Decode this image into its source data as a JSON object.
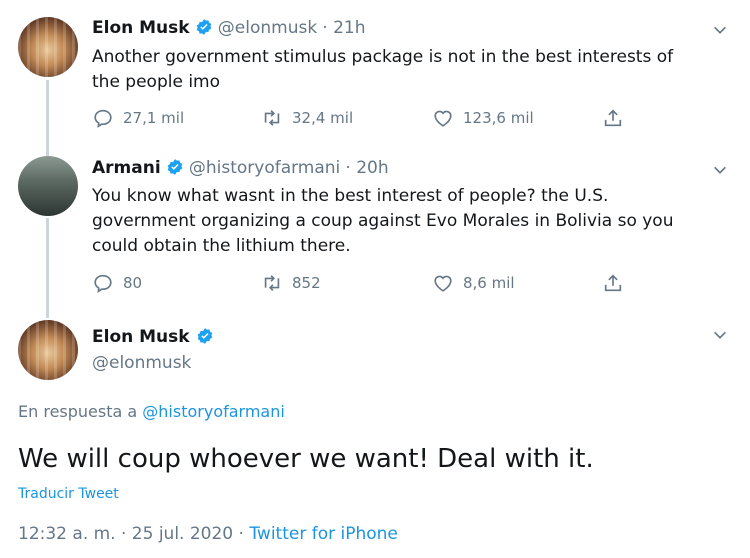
{
  "tweet1": {
    "name": "Elon Musk",
    "handle": "@elonmusk",
    "time": "· 21h",
    "text": "Another government stimulus package is not in the best interests of the people imo",
    "replies": "27,1 mil",
    "retweets": "32,4 mil",
    "likes": "123,6 mil"
  },
  "tweet2": {
    "name": "Armani",
    "handle": "@historyofarmani",
    "time": "· 20h",
    "text": "You know what wasnt in the best interest of people? the U.S. government organizing a coup against Evo Morales in Bolivia so you could obtain the lithium there.",
    "replies": "80",
    "retweets": "852",
    "likes": "8,6 mil"
  },
  "tweet3": {
    "name": "Elon Musk",
    "handle": "@elonmusk",
    "reply_prefix": "En respuesta a",
    "reply_to": "@historyofarmani",
    "text": "We will coup whoever we want! Deal with it.",
    "translate": "Traducir Tweet",
    "timestamp": "12:32 a. m. · 25 jul. 2020",
    "separator": "·",
    "source": "Twitter for iPhone"
  },
  "colors": {
    "verified_blue": "#1da1f2",
    "link_blue": "#1b95e0",
    "muted_gray": "#657786",
    "thread_line": "#ccd6dd"
  }
}
